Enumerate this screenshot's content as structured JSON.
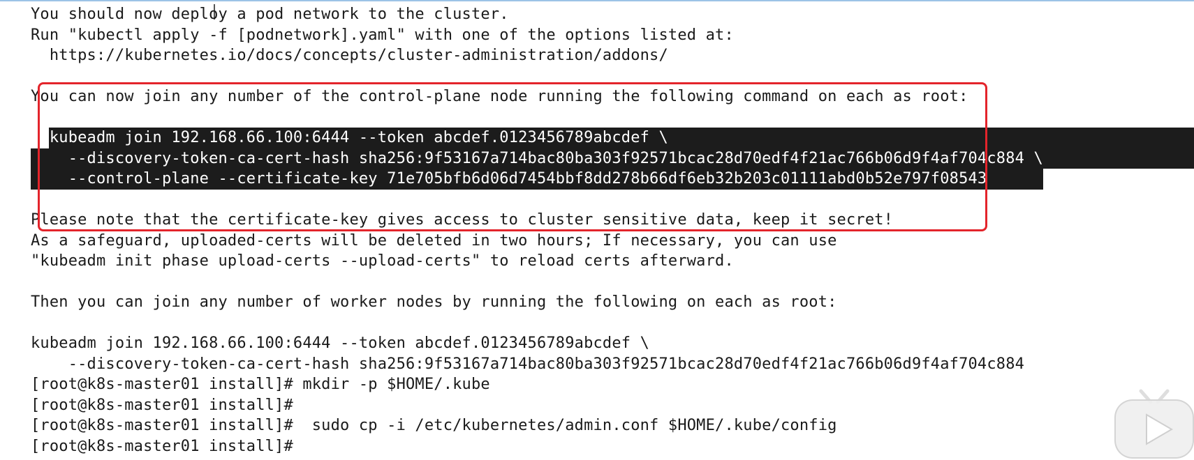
{
  "terminal": {
    "lines": [
      "You should now deploy a pod network to the cluster.",
      "Run \"kubectl apply -f [podnetwork].yaml\" with one of the options listed at:",
      "  https://kubernetes.io/docs/concepts/cluster-administration/addons/",
      "",
      "You can now join any number of the control-plane node running the following command on each as root:",
      "",
      "  kubeadm join 192.168.66.100:6444 --token abcdef.0123456789abcdef \\",
      "    --discovery-token-ca-cert-hash sha256:9f53167a714bac80ba303f92571bcac28d70edf4f21ac766b06d9f4af704c884 \\",
      "    --control-plane --certificate-key 71e705bfb6d06d7454bbf8dd278b66df6eb32b203c01111abd0b52e797f08543",
      "",
      "Please note that the certificate-key gives access to cluster sensitive data, keep it secret!",
      "As a safeguard, uploaded-certs will be deleted in two hours; If necessary, you can use",
      "\"kubeadm init phase upload-certs --upload-certs\" to reload certs afterward.",
      "",
      "Then you can join any number of worker nodes by running the following on each as root:",
      "",
      "kubeadm join 192.168.66.100:6444 --token abcdef.0123456789abcdef \\",
      "    --discovery-token-ca-cert-hash sha256:9f53167a714bac80ba303f92571bcac28d70edf4f21ac766b06d9f4af704c884",
      "[root@k8s-master01 install]# mkdir -p $HOME/.kube",
      "[root@k8s-master01 install]#",
      "[root@k8s-master01 install]#  sudo cp -i /etc/kubernetes/admin.conf $HOME/.kube/config",
      "[root@k8s-master01 install]#"
    ],
    "selected_lines": [
      6,
      7,
      8
    ]
  },
  "colors": {
    "text": "#1a1a1a",
    "selection_bg": "#1c1c1c",
    "selection_fg": "#ffffff",
    "annotation_box": "#e3242b"
  },
  "overlay": {
    "icon": "play-icon"
  }
}
